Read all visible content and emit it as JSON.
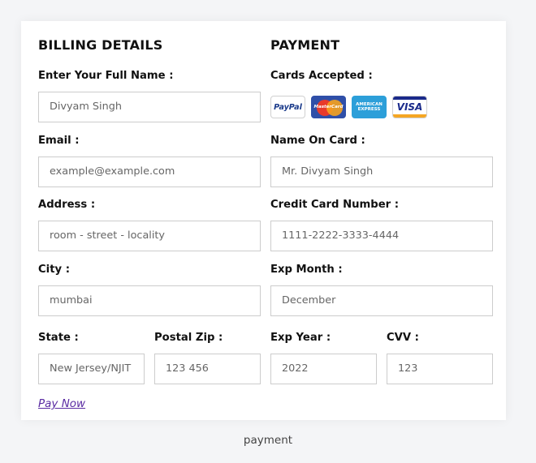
{
  "billing": {
    "title": "BILLING DETAILS",
    "full_name_label": "Enter Your Full Name :",
    "full_name_placeholder": "Divyam Singh",
    "email_label": "Email :",
    "email_placeholder": "example@example.com",
    "address_label": "Address :",
    "address_placeholder": "room - street - locality",
    "city_label": "City :",
    "city_placeholder": "mumbai",
    "state_label": "State :",
    "state_placeholder": "New Jersey/NJIT",
    "zip_label": "Postal Zip :",
    "zip_placeholder": "123 456"
  },
  "payment": {
    "title": "PAYMENT",
    "cards_label": "Cards Accepted :",
    "cards": [
      {
        "name": "PayPal",
        "icon": "paypal-icon"
      },
      {
        "name": "MasterCard",
        "icon": "mastercard-icon"
      },
      {
        "name": "AMERICAN EXPRESS",
        "icon": "amex-icon"
      },
      {
        "name": "VISA",
        "icon": "visa-icon"
      }
    ],
    "name_on_card_label": "Name On Card :",
    "name_on_card_placeholder": "Mr. Divyam Singh",
    "card_number_label": "Credit Card Number :",
    "card_number_placeholder": "1111-2222-3333-4444",
    "exp_month_label": "Exp Month :",
    "exp_month_placeholder": "December",
    "exp_year_label": "Exp Year :",
    "exp_year_placeholder": "2022",
    "cvv_label": "CVV :",
    "cvv_placeholder": "123"
  },
  "actions": {
    "pay_now": "Pay Now"
  },
  "caption": "payment"
}
